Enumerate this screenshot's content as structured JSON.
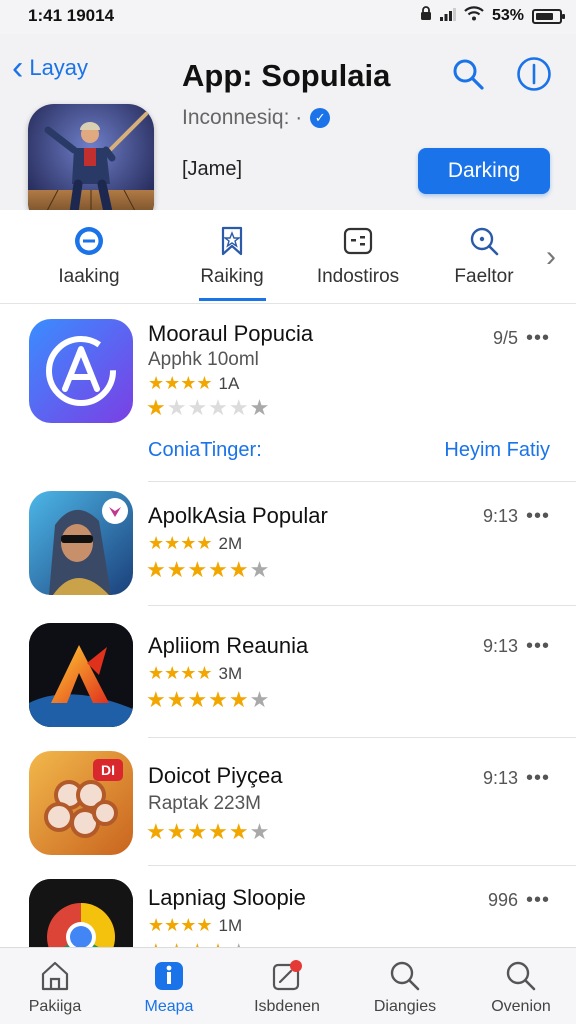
{
  "status": {
    "time": "1:41 19014",
    "battery": "53%"
  },
  "header": {
    "back_label": "Layay",
    "title": "App: Sopulaia",
    "developer": "Inconnesiq: ·",
    "tag": "[Jame]",
    "primary_button": "Darking"
  },
  "tabs": [
    {
      "label": "Iaaking"
    },
    {
      "label": "Raiking"
    },
    {
      "label": "Indostiros"
    },
    {
      "label": "Faeltor"
    }
  ],
  "apps": [
    {
      "title": "Mooraul Popucia",
      "subtitle": "Apphk 10oml",
      "stars_text": "1A",
      "meta": "9/5",
      "link_left": "ConiaTinger:",
      "link_right": "Heyim Fatiy"
    },
    {
      "title": "ApolkAsia Popular",
      "stars_text": "2M",
      "meta": "9:13"
    },
    {
      "title": "Apliiom Reaunia",
      "stars_text": "3M",
      "meta": "9:13"
    },
    {
      "title": "Doicot Piyçea",
      "subtitle": "Raptak 223M",
      "meta": "9:13"
    },
    {
      "title": "Lapniag Sloopie",
      "stars_text": "1M",
      "meta": "996"
    }
  ],
  "tabbar": [
    {
      "label": "Pakiiga"
    },
    {
      "label": "Meapa"
    },
    {
      "label": "Isbdenen"
    },
    {
      "label": "Diangies"
    },
    {
      "label": "Ovenion"
    }
  ],
  "colors": {
    "accent": "#1a73e8",
    "star": "#f2a600"
  }
}
